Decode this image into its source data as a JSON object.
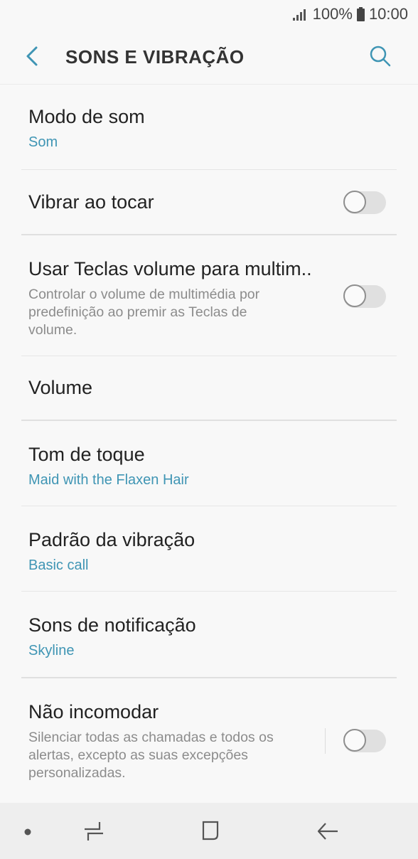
{
  "status_bar": {
    "battery": "100%",
    "time": "10:00"
  },
  "app_bar": {
    "title": "SONS E VIBRAÇÃO"
  },
  "settings": {
    "sound_mode": {
      "label": "Modo de som",
      "value": "Som"
    },
    "vibrate_on_touch": {
      "label": "Vibrar ao tocar",
      "enabled": false
    },
    "volume_keys_media": {
      "label": "Usar Teclas volume para multim..",
      "description": "Controlar o volume de multimédia por predefinição ao premir as Teclas de volume.",
      "enabled": false
    },
    "volume": {
      "label": "Volume"
    },
    "ringtone": {
      "label": "Tom de toque",
      "value": "Maid with the Flaxen Hair"
    },
    "vibration_pattern": {
      "label": "Padrão da vibração",
      "value": "Basic call"
    },
    "notification_sounds": {
      "label": "Sons de notificação",
      "value": "Skyline"
    },
    "do_not_disturb": {
      "label": "Não incomodar",
      "description": "Silenciar todas as chamadas e todos os alertas, excepto as suas excepções personalizadas.",
      "enabled": false
    }
  },
  "colors": {
    "accent": "#3f95b4",
    "background": "#f8f8f8",
    "nav_bar": "#eeeeee"
  }
}
